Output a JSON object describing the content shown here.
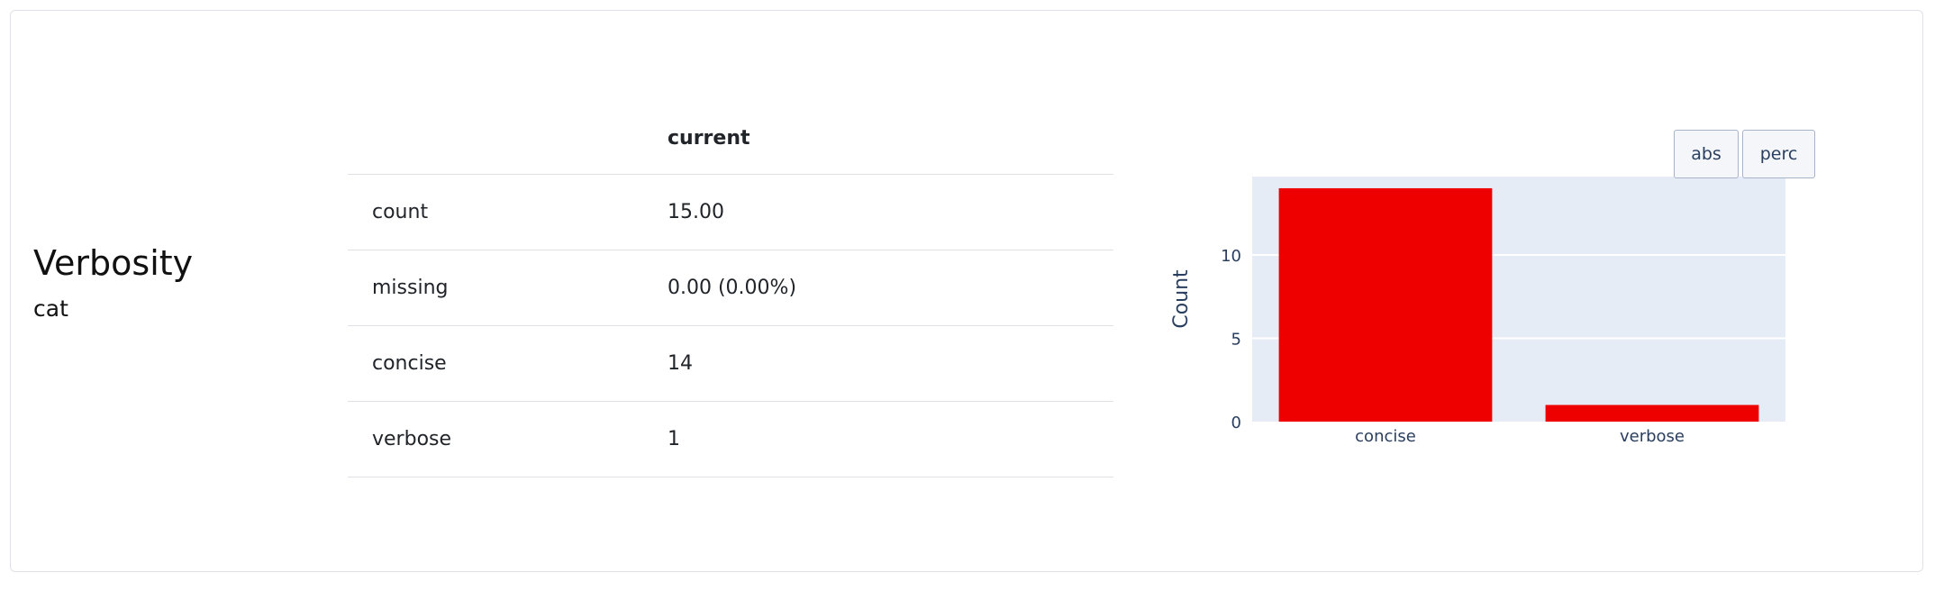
{
  "feature": {
    "name": "Verbosity",
    "type": "cat"
  },
  "stats_table": {
    "header": [
      "",
      "current"
    ],
    "rows": [
      {
        "label": "count",
        "value": "15.00"
      },
      {
        "label": "missing",
        "value": "0.00 (0.00%)"
      },
      {
        "label": "concise",
        "value": "14"
      },
      {
        "label": "verbose",
        "value": "1"
      }
    ]
  },
  "chart_controls": {
    "abs_label": "abs",
    "perc_label": "perc"
  },
  "colors": {
    "bar": "#ee0000",
    "plot_bg": "#e5ecf6",
    "axis_text": "#2a3f5f"
  },
  "chart_data": {
    "type": "bar",
    "categories": [
      "concise",
      "verbose"
    ],
    "values": [
      14,
      1
    ],
    "ylabel": "Count",
    "xlabel": "",
    "yticks": [
      0,
      5,
      10
    ],
    "ylim": [
      0,
      14.7
    ],
    "grid": true
  }
}
